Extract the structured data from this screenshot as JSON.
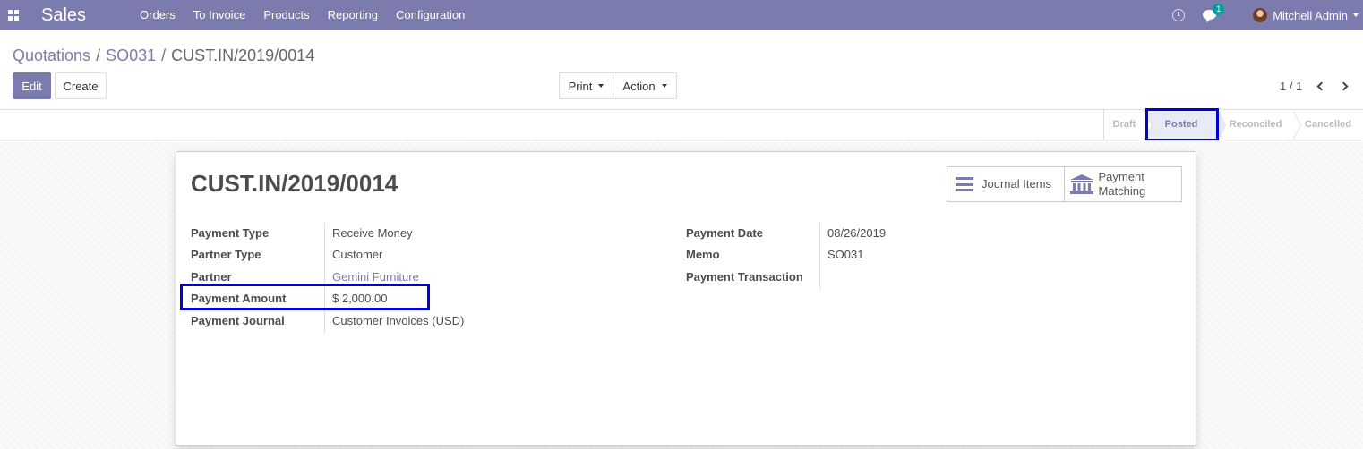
{
  "navbar": {
    "app_name": "Sales",
    "menu": [
      "Orders",
      "To Invoice",
      "Products",
      "Reporting",
      "Configuration"
    ],
    "chat_badge": "1",
    "user_name": "Mitchell Admin"
  },
  "breadcrumb": {
    "items": [
      "Quotations",
      "SO031"
    ],
    "current": "CUST.IN/2019/0014"
  },
  "controls": {
    "edit_label": "Edit",
    "create_label": "Create",
    "print_label": "Print",
    "action_label": "Action",
    "pager": "1 / 1"
  },
  "statusbar": {
    "stages": [
      "Draft",
      "Posted",
      "Reconciled",
      "Cancelled"
    ],
    "active": "Posted"
  },
  "record": {
    "title": "CUST.IN/2019/0014",
    "smart_buttons": {
      "journal_items": "Journal Items",
      "payment_matching_line1": "Payment",
      "payment_matching_line2": "Matching"
    },
    "left_fields": [
      {
        "label": "Payment Type",
        "value": "Receive Money"
      },
      {
        "label": "Partner Type",
        "value": "Customer"
      },
      {
        "label": "Partner",
        "value": "Gemini Furniture"
      },
      {
        "label": "Payment Amount",
        "value": "$ 2,000.00"
      },
      {
        "label": "Payment Journal",
        "value": "Customer Invoices (USD)"
      }
    ],
    "right_fields": [
      {
        "label": "Payment Date",
        "value": "08/26/2019"
      },
      {
        "label": "Memo",
        "value": "SO031"
      },
      {
        "label": "Payment Transaction",
        "value": ""
      }
    ]
  },
  "colors": {
    "brand": "#7c7bad",
    "highlight": "#0000d8",
    "posted_bg": "#e8ebf4"
  }
}
